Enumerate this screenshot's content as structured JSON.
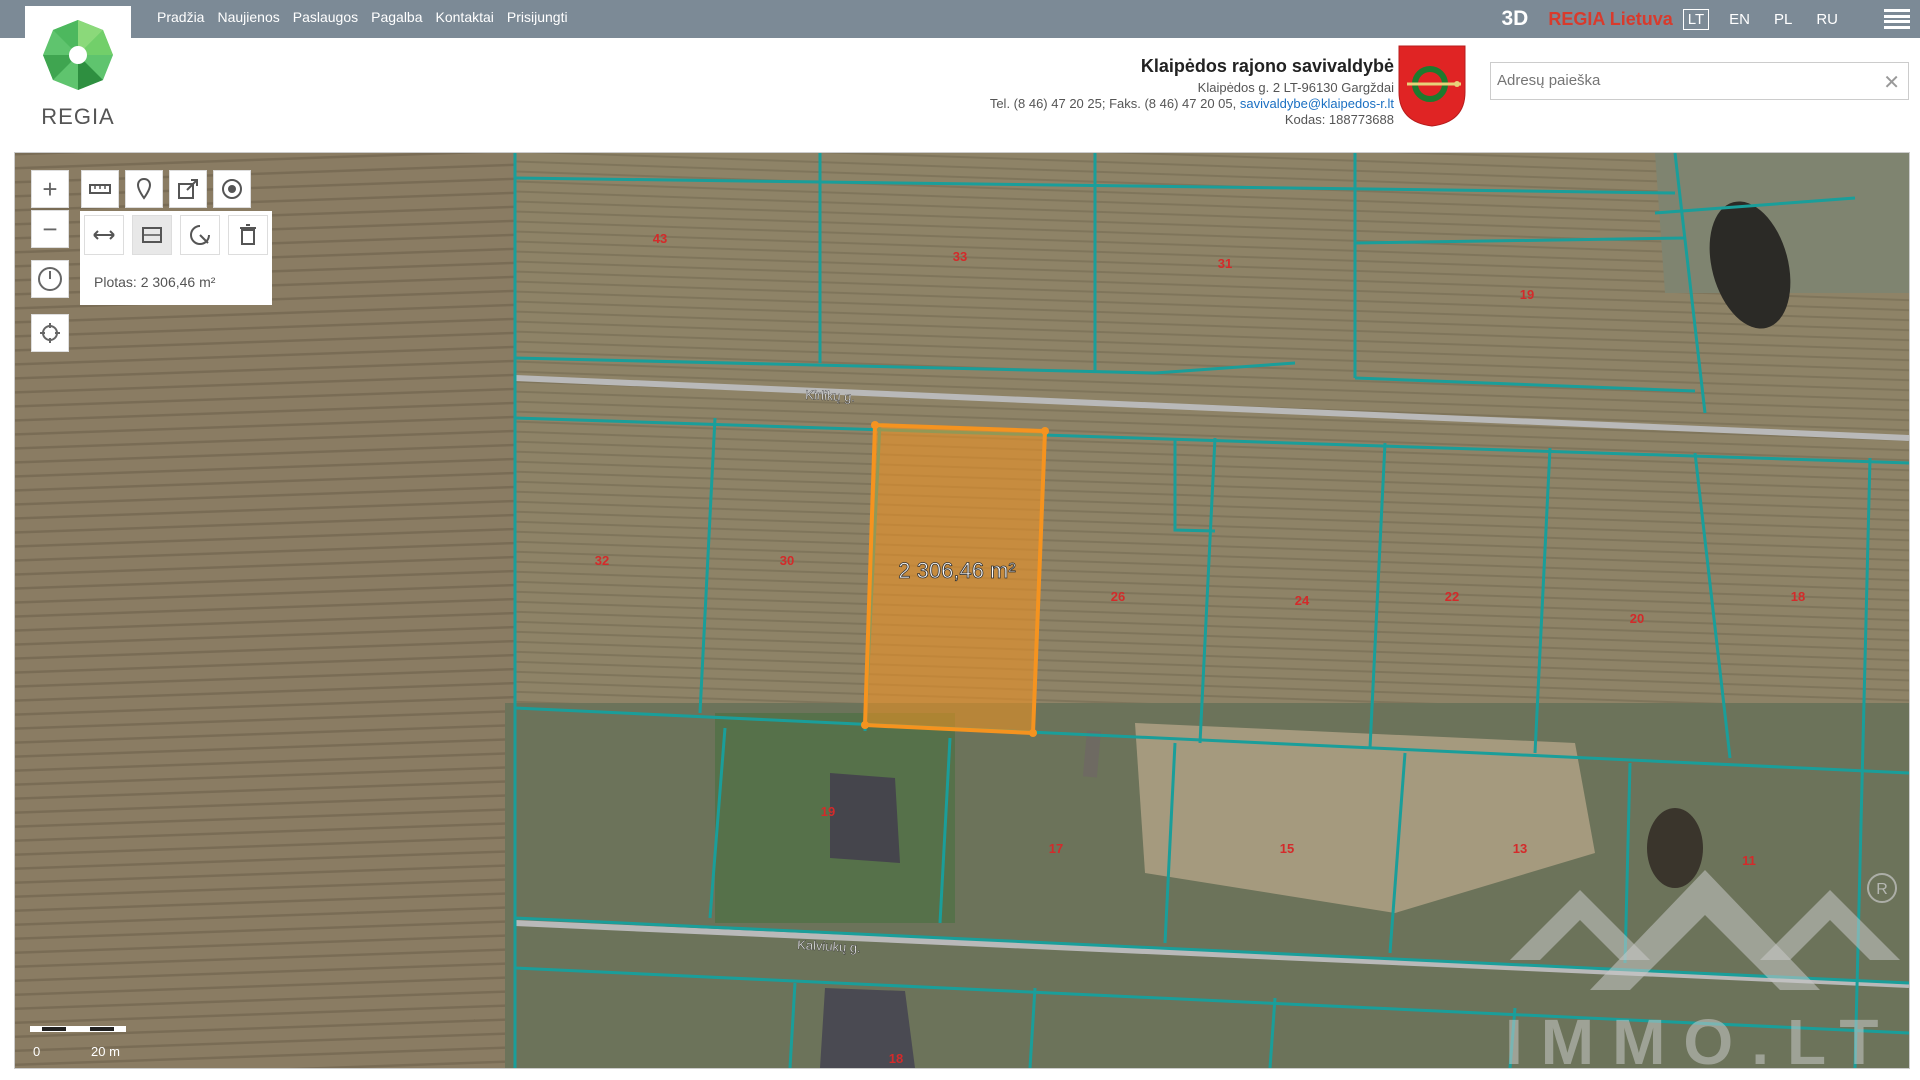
{
  "nav": [
    "Pradžia",
    "Naujienos",
    "Paslaugos",
    "Pagalba",
    "Kontaktai",
    "Prisijungti"
  ],
  "brand": {
    "logo_text": "REGIA"
  },
  "top_right": {
    "btn_3d": "3D",
    "regia_lietuva": "REGIA Lietuva",
    "languages": [
      "LT",
      "EN",
      "PL",
      "RU"
    ],
    "active_language": "LT"
  },
  "municipality": {
    "name": "Klaipėdos rajono savivaldybė",
    "address": "Klaipėdos g. 2 LT-96130 Gargždai",
    "phone_fax": "Tel. (8 46) 47 20 25; Faks. (8 46) 47 20 05,",
    "email": "savivaldybe@klaipedos-r.lt",
    "code": "Kodas: 188773688"
  },
  "search": {
    "placeholder": "Adresų paieška"
  },
  "measure": {
    "area_label": "Plotas: 2 306,46 m²",
    "map_label": "2 306,46 m²"
  },
  "streets": [
    "Kirlikų g.",
    "Kalviukų g."
  ],
  "parcels": [
    "43",
    "33",
    "31",
    "19",
    "32",
    "30",
    "26",
    "24",
    "22",
    "20",
    "18",
    "19",
    "17",
    "15",
    "13",
    "11",
    "18"
  ],
  "scale": {
    "zero": "0",
    "length": "20 m"
  },
  "watermark": "IMMO.LT",
  "colors": {
    "parcel_line": "#1a9e9a",
    "highlight": "#f5931f",
    "topbar": "#7c8a96"
  }
}
